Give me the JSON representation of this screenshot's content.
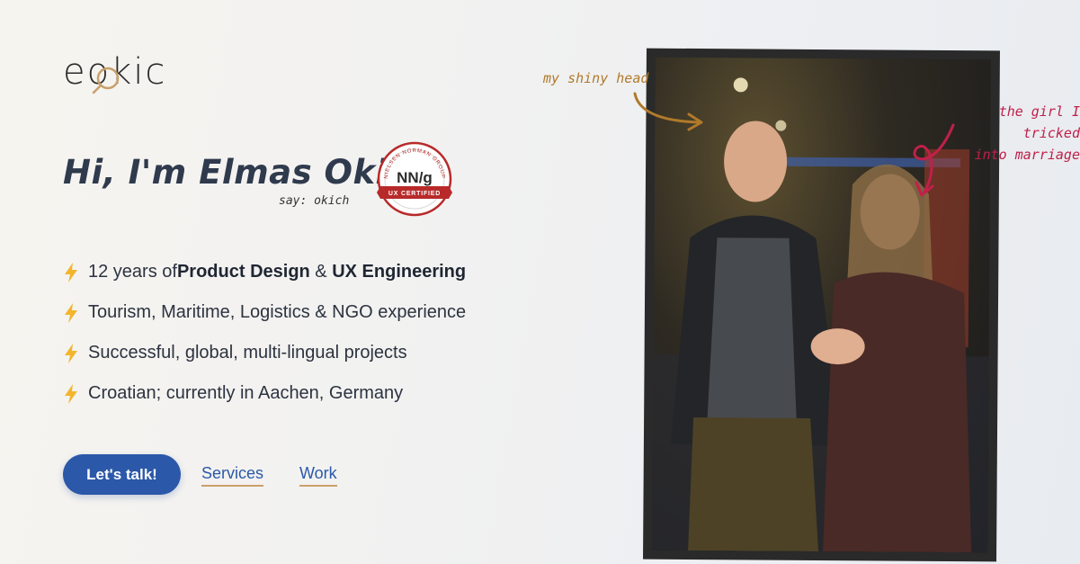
{
  "logo": {
    "text": "eokic"
  },
  "hero": {
    "greeting": "Hi, I'm Elmas Okić!",
    "pronunciation": "say: okich"
  },
  "badge": {
    "org": "NIELSEN NORMAN GROUP",
    "mark": "NN/g",
    "ribbon": "UX CERTIFIED"
  },
  "bullets": [
    {
      "pre": "12 years of ",
      "b1": "Product Design",
      "mid": " & ",
      "b2": "UX Engineering"
    },
    {
      "text": "Tourism, Maritime, Logistics & NGO experience"
    },
    {
      "text": "Successful, global, multi-lingual projects"
    },
    {
      "text": "Croatian; currently in Aachen, Germany"
    }
  ],
  "actions": {
    "cta": "Let's talk!",
    "services": "Services",
    "work": "Work"
  },
  "annotations": {
    "head": "my shiny head",
    "girl_line1": "the girl I tricked",
    "girl_line2": "into marriage"
  },
  "colors": {
    "accent": "#2b58a8",
    "gold": "#c9a06a",
    "annotation_gold": "#b07a2a",
    "annotation_red": "#c0204a",
    "badge_red": "#b82a2a"
  }
}
